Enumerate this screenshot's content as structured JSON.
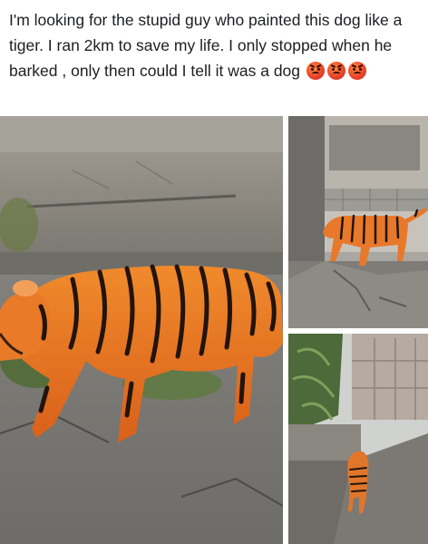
{
  "post": {
    "text": "I'm looking for the stupid guy who painted this dog like a tiger. I ran 2km to save my life. I only stopped when he barked , only then could I tell it was a dog",
    "emojis": [
      "angry-face-icon",
      "angry-face-icon",
      "angry-face-icon"
    ]
  },
  "photos": [
    {
      "id": "main",
      "subject": "dog painted like a tiger walking on pavement"
    },
    {
      "id": "top-right",
      "subject": "tiger-painted dog near a wall"
    },
    {
      "id": "bottom-right",
      "subject": "tiger-painted dog walking down a lane"
    }
  ],
  "colors": {
    "text": "#1c1e21",
    "tiger_orange": "#e8701e",
    "stripe": "#2a1a10",
    "concrete": "#8c8a84"
  }
}
